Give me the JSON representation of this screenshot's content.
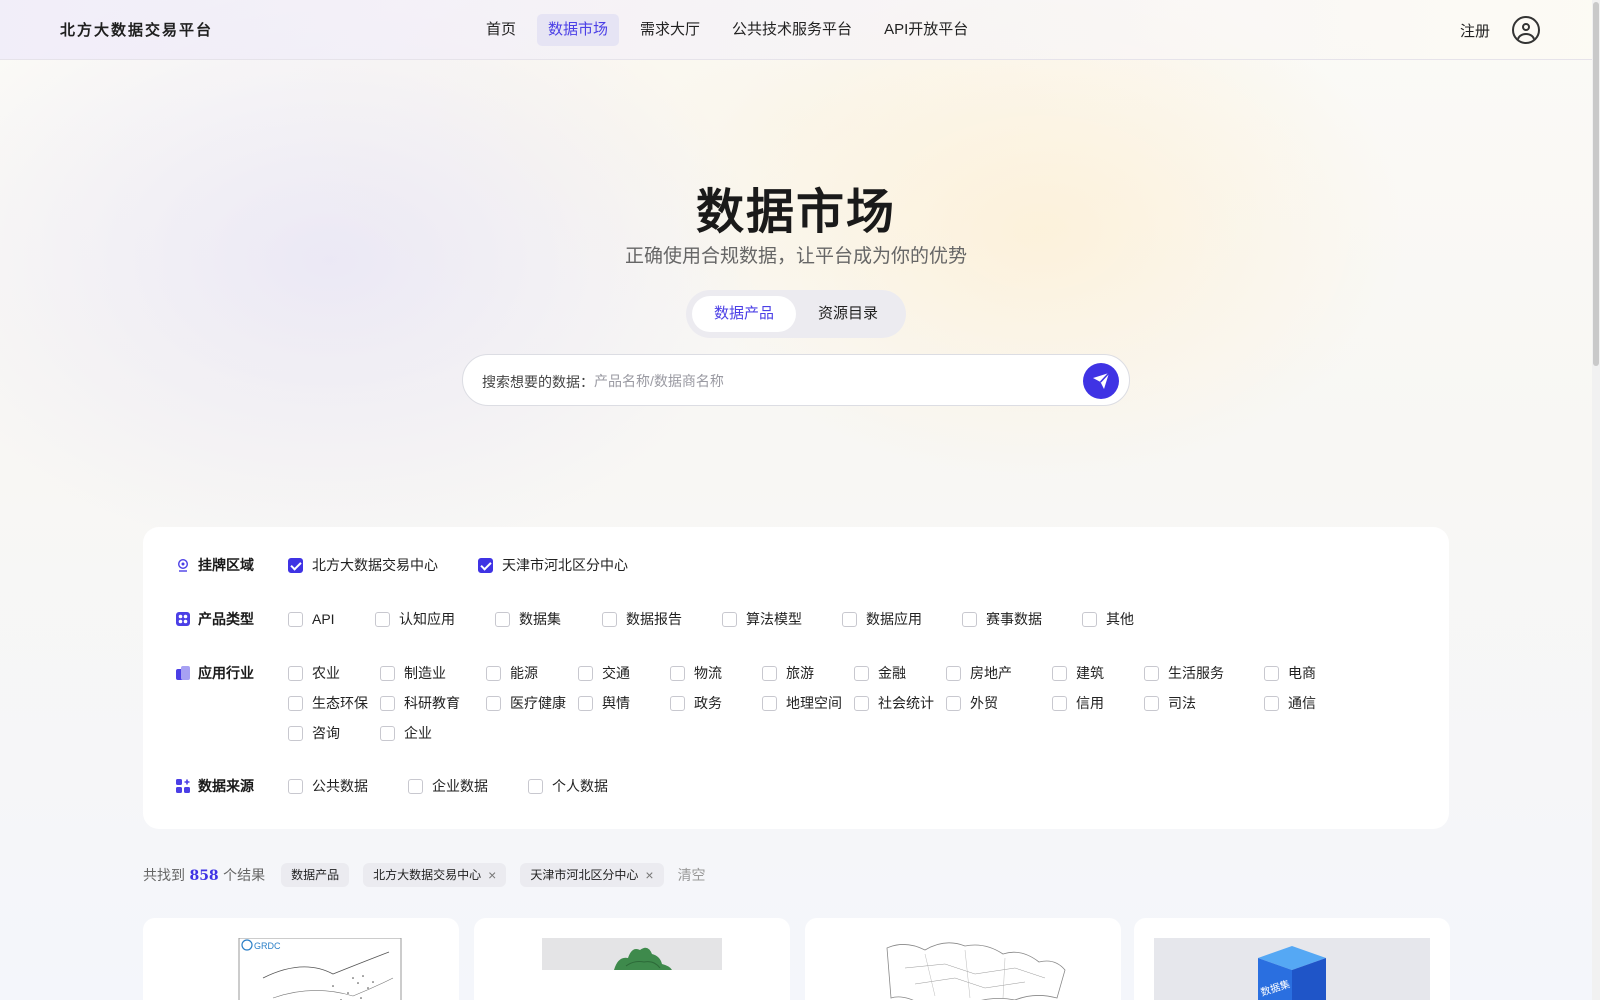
{
  "header": {
    "logo": "北方大数据交易平台",
    "nav": [
      {
        "label": "首页",
        "active": false
      },
      {
        "label": "数据市场",
        "active": true
      },
      {
        "label": "需求大厅",
        "active": false
      },
      {
        "label": "公共技术服务平台",
        "active": false
      },
      {
        "label": "API开放平台",
        "active": false
      }
    ],
    "register": "注册",
    "avatar_icon": "user-avatar-icon"
  },
  "hero": {
    "title": "数据市场",
    "subtitle": "正确使用合规数据，让平台成为你的优势",
    "tabs": [
      {
        "label": "数据产品",
        "active": true
      },
      {
        "label": "资源目录",
        "active": false
      }
    ]
  },
  "search": {
    "prefix": "搜索想要的数据：",
    "placeholder": "产品名称/数据商名称",
    "value": "",
    "button_icon": "paper-plane-icon"
  },
  "filters": {
    "listing_area": {
      "label": "挂牌区域",
      "icon": "location-icon",
      "options": [
        {
          "label": "北方大数据交易中心",
          "checked": true
        },
        {
          "label": "天津市河北区分中心",
          "checked": true
        }
      ]
    },
    "product_type": {
      "label": "产品类型",
      "icon": "grid-icon",
      "options": [
        {
          "label": "API",
          "checked": false
        },
        {
          "label": "认知应用",
          "checked": false
        },
        {
          "label": "数据集",
          "checked": false
        },
        {
          "label": "数据报告",
          "checked": false
        },
        {
          "label": "算法模型",
          "checked": false
        },
        {
          "label": "数据应用",
          "checked": false
        },
        {
          "label": "赛事数据",
          "checked": false
        },
        {
          "label": "其他",
          "checked": false
        }
      ]
    },
    "industry": {
      "label": "应用行业",
      "icon": "industry-icon",
      "options": [
        {
          "label": "农业",
          "checked": false
        },
        {
          "label": "制造业",
          "checked": false
        },
        {
          "label": "能源",
          "checked": false
        },
        {
          "label": "交通",
          "checked": false
        },
        {
          "label": "物流",
          "checked": false
        },
        {
          "label": "旅游",
          "checked": false
        },
        {
          "label": "金融",
          "checked": false
        },
        {
          "label": "房地产",
          "checked": false
        },
        {
          "label": "建筑",
          "checked": false
        },
        {
          "label": "生活服务",
          "checked": false
        },
        {
          "label": "电商",
          "checked": false
        },
        {
          "label": "生态环保",
          "checked": false
        },
        {
          "label": "科研教育",
          "checked": false
        },
        {
          "label": "医疗健康",
          "checked": false
        },
        {
          "label": "舆情",
          "checked": false
        },
        {
          "label": "政务",
          "checked": false
        },
        {
          "label": "地理空间",
          "checked": false
        },
        {
          "label": "社会统计",
          "checked": false
        },
        {
          "label": "外贸",
          "checked": false
        },
        {
          "label": "信用",
          "checked": false
        },
        {
          "label": "司法",
          "checked": false
        },
        {
          "label": "通信",
          "checked": false
        },
        {
          "label": "咨询",
          "checked": false
        },
        {
          "label": "企业",
          "checked": false
        }
      ]
    },
    "data_source": {
      "label": "数据来源",
      "icon": "apps-icon",
      "options": [
        {
          "label": "公共数据",
          "checked": false
        },
        {
          "label": "企业数据",
          "checked": false
        },
        {
          "label": "个人数据",
          "checked": false
        }
      ]
    }
  },
  "results": {
    "prefix": "共找到",
    "count": "858",
    "suffix": "个结果",
    "tags": [
      {
        "label": "数据产品",
        "removable": false
      },
      {
        "label": "北方大数据交易中心",
        "removable": true
      },
      {
        "label": "天津市河北区分中心",
        "removable": true
      }
    ],
    "clear": "清空"
  },
  "cards": [
    {
      "thumb": "map-thumbnail",
      "badge": "GRDC"
    },
    {
      "thumb": "green-map-thumbnail"
    },
    {
      "thumb": "line-map-thumbnail"
    },
    {
      "thumb": "cube-thumbnail",
      "badge": "数据集"
    }
  ],
  "colors": {
    "accent": "#3f33e4",
    "nav_active_bg": "#e6e4f4"
  }
}
